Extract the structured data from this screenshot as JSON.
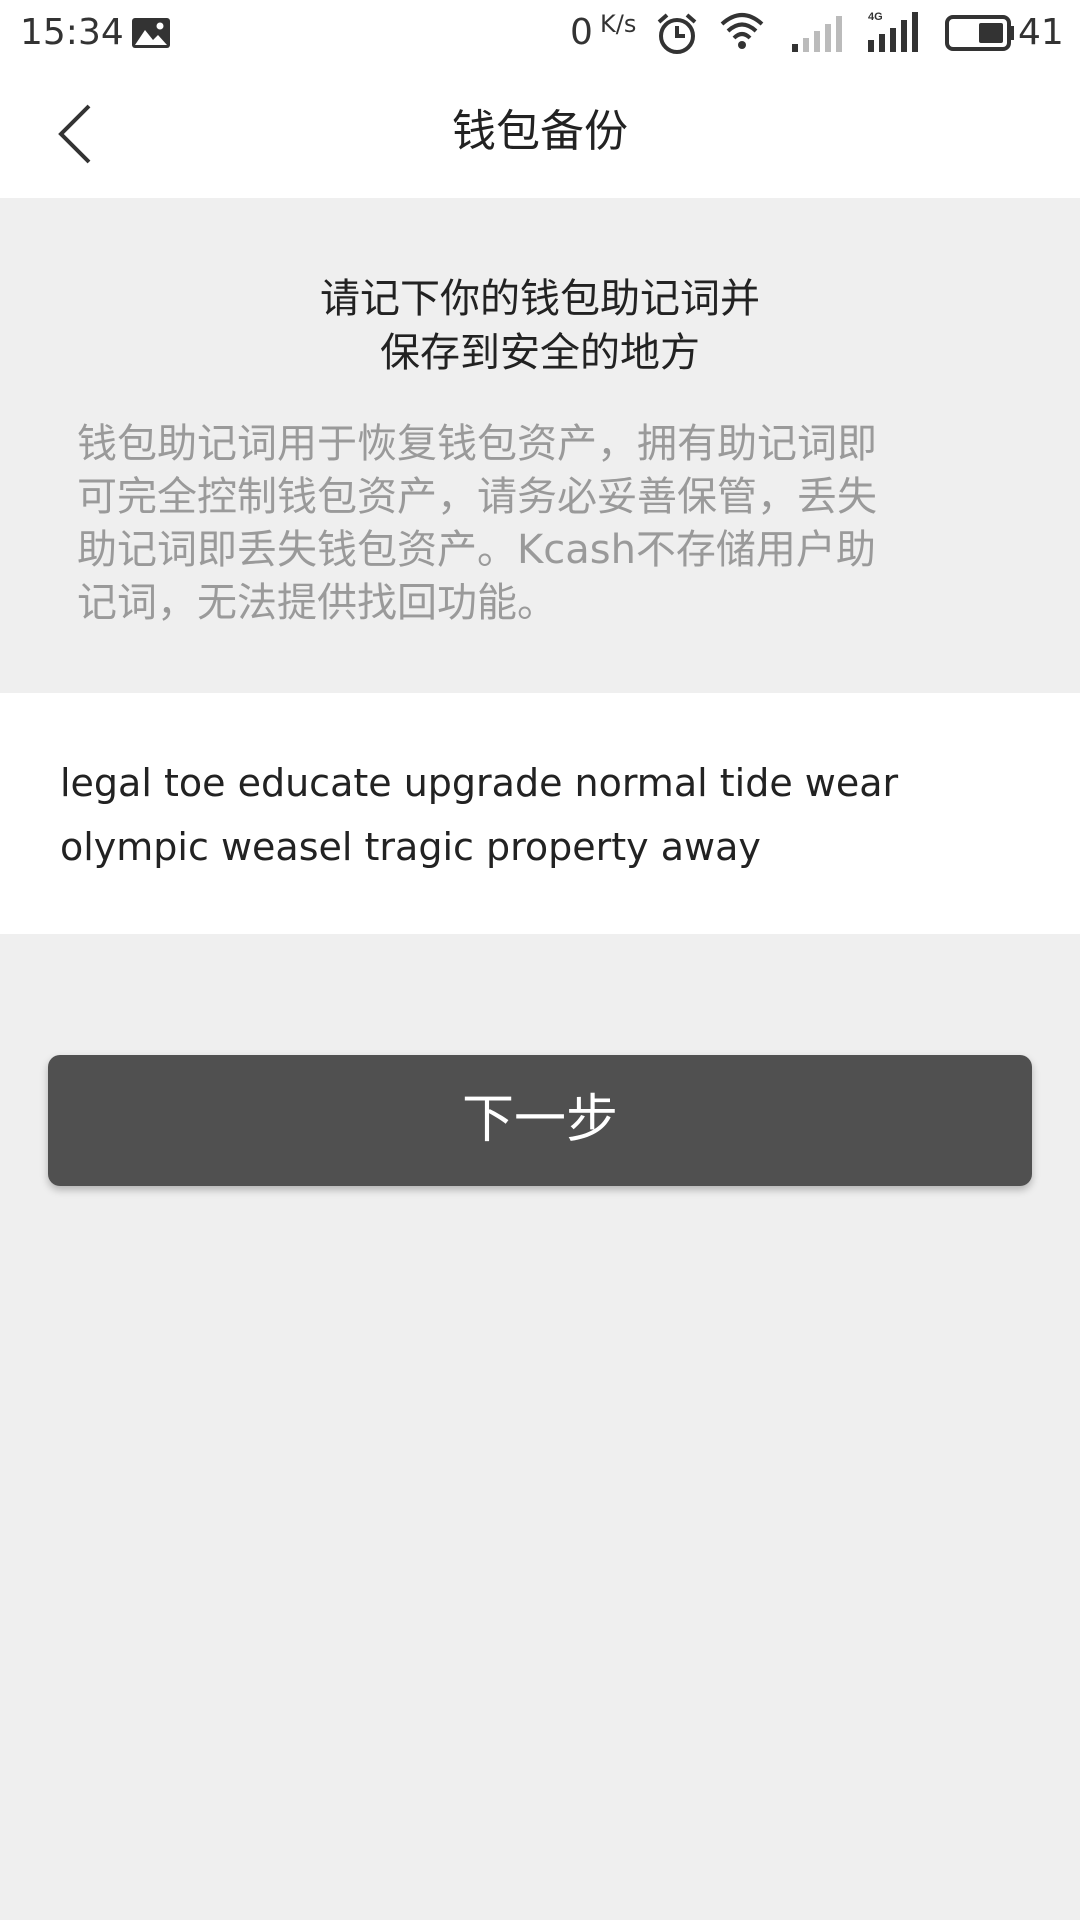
{
  "status_bar": {
    "time": "15:34",
    "net_speed": "0",
    "net_speed_unit": "K/s",
    "battery_level": "41",
    "icons": [
      "gallery-icon",
      "alarm-icon",
      "wifi-icon",
      "signal-icon",
      "signal-4g-icon",
      "battery-icon"
    ]
  },
  "header": {
    "title": "钱包备份",
    "back_icon": "chevron-left-icon"
  },
  "intro": {
    "heading_line1": "请记下你的钱包助记词并",
    "heading_line2": "保存到安全的地方",
    "body_line1": "钱包助记词用于恢复钱包资产，拥有助记词即",
    "body_line2": "可完全控制钱包资产，请务必妥善保管，丢失",
    "body_line3": "助记词即丢失钱包资产。Kcash不存储用户助",
    "body_line4": "记词，无法提供找回功能。"
  },
  "mnemonic": {
    "line1": "legal toe educate upgrade normal tide wear",
    "line2": "olympic weasel tragic property away"
  },
  "actions": {
    "next_label": "下一步"
  },
  "colors": {
    "background": "#efefef",
    "button": "#505050",
    "muted_text": "#9a9a9a"
  }
}
